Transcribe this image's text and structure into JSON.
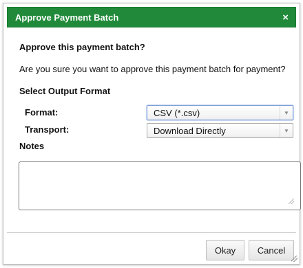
{
  "dialog": {
    "title": "Approve Payment Batch",
    "close_glyph": "×",
    "close_icon": "close-icon",
    "heading": "Approve this payment batch?",
    "confirm_text": "Are you sure you want to approve this payment batch for payment?",
    "section_title": "Select Output Format",
    "title_bar_color": "#218a3a"
  },
  "form": {
    "format": {
      "label": "Format:",
      "value": "CSV (*.csv)",
      "arrow_icon": "dropdown-arrow-icon"
    },
    "transport": {
      "label": "Transport:",
      "value": "Download Directly",
      "arrow_icon": "dropdown-arrow-icon"
    },
    "notes": {
      "label": "Notes",
      "value": ""
    }
  },
  "buttons": {
    "okay": "Okay",
    "cancel": "Cancel"
  }
}
